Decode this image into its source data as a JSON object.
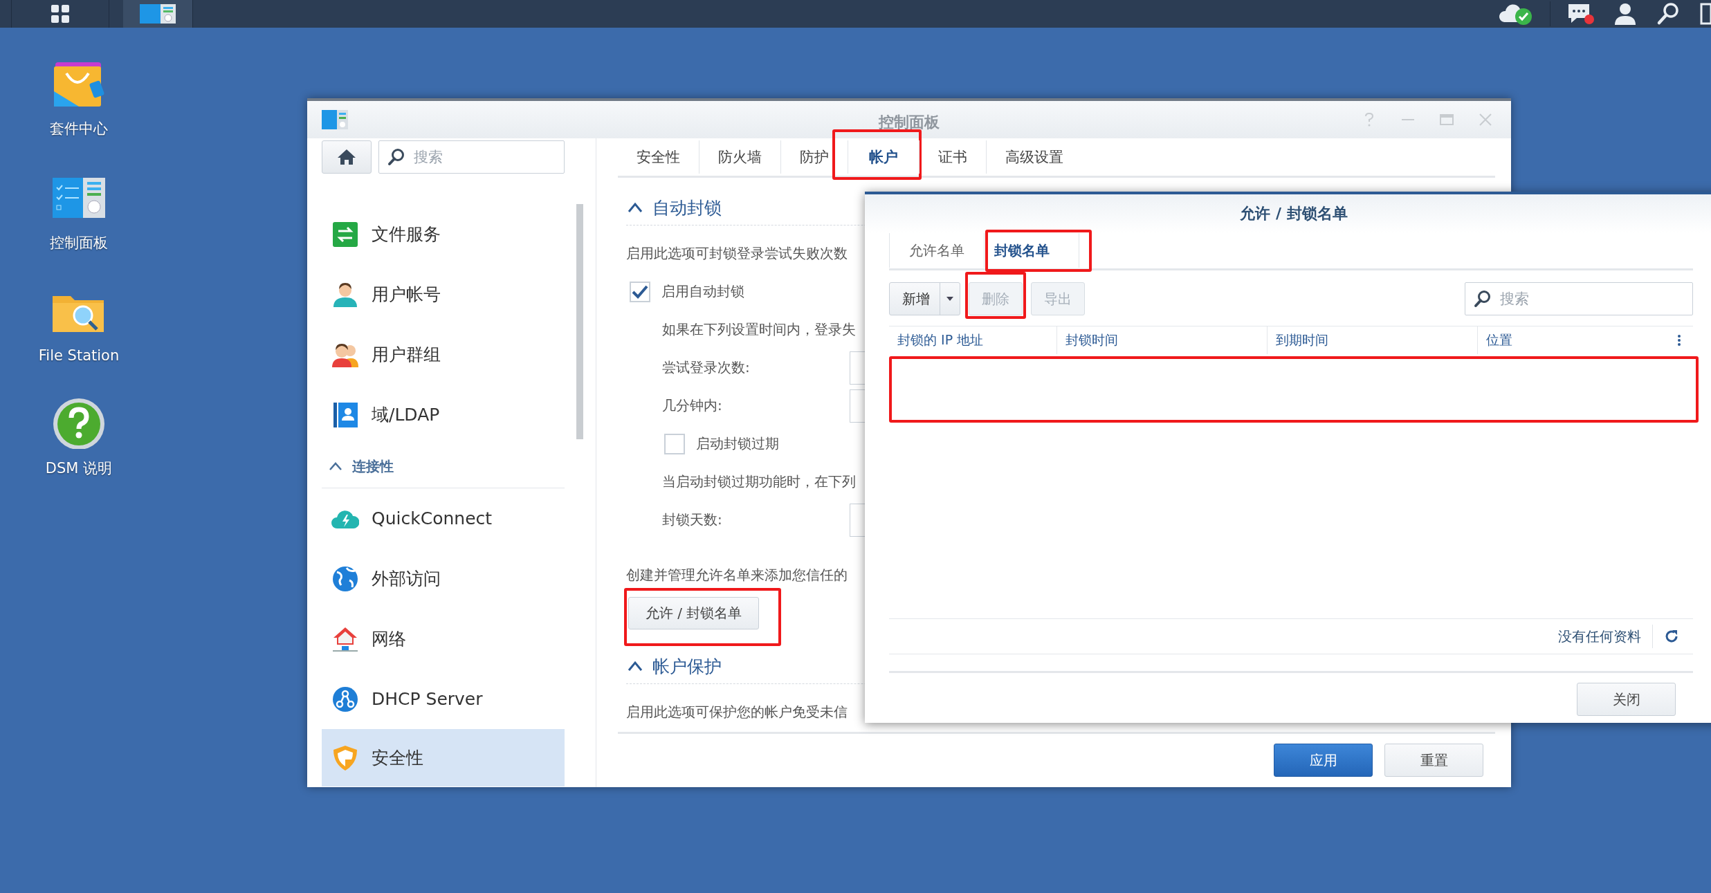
{
  "desktop": {
    "shortcuts": [
      {
        "label": "套件中心"
      },
      {
        "label": "控制面板"
      },
      {
        "label": "File Station"
      },
      {
        "label": "DSM 说明"
      }
    ]
  },
  "window": {
    "title": "控制面板",
    "sidebar": {
      "search": {
        "placeholder": "搜索"
      },
      "items": [
        {
          "kind": "item",
          "label": "文件服务",
          "selected": false
        },
        {
          "kind": "item",
          "label": "用户帐号",
          "selected": false
        },
        {
          "kind": "item",
          "label": "用户群组",
          "selected": false
        },
        {
          "kind": "item",
          "label": "域/LDAP",
          "selected": false
        },
        {
          "kind": "section",
          "label": "连接性",
          "expanded": true
        },
        {
          "kind": "item",
          "label": "QuickConnect",
          "selected": false
        },
        {
          "kind": "item",
          "label": "外部访问",
          "selected": false
        },
        {
          "kind": "item",
          "label": "网络",
          "selected": false
        },
        {
          "kind": "item",
          "label": "DHCP Server",
          "selected": false
        },
        {
          "kind": "item",
          "label": "安全性",
          "selected": true
        }
      ]
    },
    "tabs": [
      {
        "label": "安全性",
        "selected": false,
        "highlighted": false
      },
      {
        "label": "防火墙",
        "selected": false,
        "highlighted": false
      },
      {
        "label": "防护",
        "selected": false,
        "highlighted": false
      },
      {
        "label": "帐户",
        "selected": true,
        "highlighted": true
      },
      {
        "label": "证书",
        "selected": false,
        "highlighted": false
      },
      {
        "label": "高级设置",
        "selected": false,
        "highlighted": false
      }
    ],
    "sections": [
      {
        "title": "自动封锁",
        "expanded": true,
        "rows": [
          {
            "kind": "text",
            "text": "启用此选项可封锁登录尝试失败次数"
          },
          {
            "kind": "checkbox",
            "label": "启用自动封锁",
            "checked": true,
            "children": [
              {
                "kind": "text",
                "text": "如果在下列设置时间内，登录失"
              },
              {
                "kind": "field",
                "label": "尝试登录次数:"
              },
              {
                "kind": "field",
                "label": "几分钟内:"
              },
              {
                "kind": "checkbox",
                "label": "启动封锁过期",
                "checked": false
              },
              {
                "kind": "text",
                "text": "当启动封锁过期功能时，在下列"
              },
              {
                "kind": "field",
                "label": "封锁天数:"
              }
            ]
          },
          {
            "kind": "text",
            "text": "创建并管理允许名单来添加您信任的"
          },
          {
            "kind": "button",
            "label": "允许 / 封锁名单",
            "highlighted": true
          }
        ]
      },
      {
        "title": "帐户保护",
        "expanded": true,
        "rows": [
          {
            "kind": "text",
            "text": "启用此选项可保护您的帐户免受未信"
          }
        ]
      }
    ],
    "buttons": [
      {
        "kind": "primary",
        "label": "应用"
      },
      {
        "kind": "default",
        "label": "重置"
      }
    ]
  },
  "dialog": {
    "title": "允许 / 封锁名单",
    "tabs": [
      {
        "label": "允许名单",
        "selected": false,
        "highlighted": false
      },
      {
        "label": "封锁名单",
        "selected": true,
        "highlighted": true
      }
    ],
    "toolbar": [
      {
        "kind": "split",
        "label": "新增",
        "disabled": false,
        "highlighted": false
      },
      {
        "kind": "button",
        "label": "删除",
        "disabled": true,
        "highlighted": true
      },
      {
        "kind": "button",
        "label": "导出",
        "disabled": true,
        "highlighted": false
      }
    ],
    "search": {
      "placeholder": "搜索"
    },
    "table": {
      "columns": [
        "封锁的 IP 地址",
        "封锁时间",
        "到期时间",
        "位置"
      ],
      "highlighted": true
    },
    "status": "没有任何资料",
    "buttons": [
      {
        "label": "关闭"
      }
    ]
  }
}
